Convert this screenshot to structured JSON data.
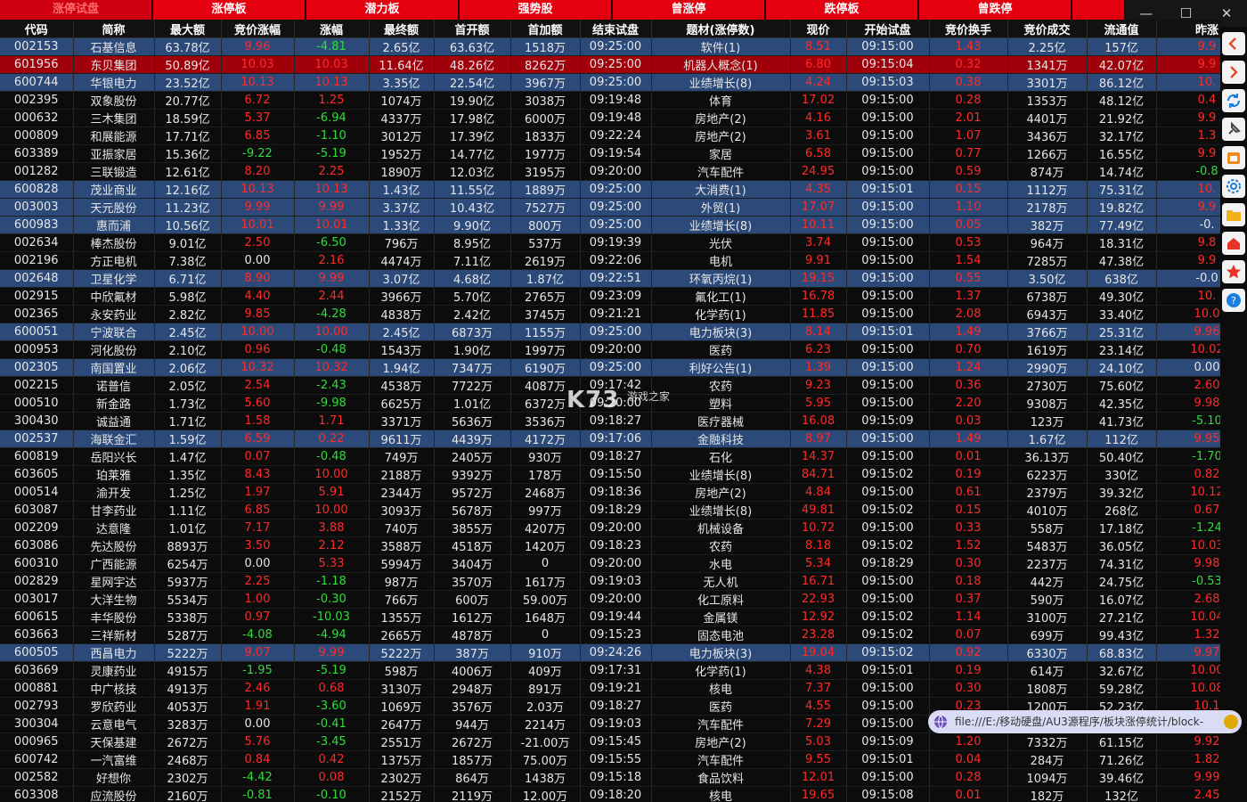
{
  "tabs": [
    "涨停试盘",
    "涨停板",
    "潜力板",
    "强势股",
    "曾涨停",
    "跌停板",
    "曾跌停",
    ""
  ],
  "window_controls": {
    "minimize": "—",
    "maximize": "☐",
    "close": "✕"
  },
  "columns": [
    "代码",
    "简称",
    "最大额",
    "竞价涨幅",
    "涨幅",
    "最终额",
    "首开额",
    "首加额",
    "结束试盘",
    "题材(涨停数)",
    "现价",
    "开始试盘",
    "竞价换手",
    "竞价成交",
    "流通值",
    "昨涨"
  ],
  "rows": [
    {
      "hl": "blue",
      "c": [
        "002153",
        "石基信息",
        "63.78亿",
        "9.96",
        "-4.81",
        "2.65亿",
        "63.63亿",
        "1518万",
        "09:25:00",
        "软件(1)",
        "8.51",
        "09:15:00",
        "1.43",
        "2.25亿",
        "157亿",
        "9.9"
      ]
    },
    {
      "hl": "red",
      "c": [
        "601956",
        "东贝集团",
        "50.89亿",
        "10.03",
        "10.03",
        "11.64亿",
        "48.26亿",
        "8262万",
        "09:25:00",
        "机器人概念(1)",
        "6.80",
        "09:15:04",
        "0.32",
        "1341万",
        "42.07亿",
        "9.9"
      ]
    },
    {
      "hl": "blue",
      "c": [
        "600744",
        "华银电力",
        "23.52亿",
        "10.13",
        "10.13",
        "3.35亿",
        "22.54亿",
        "3967万",
        "09:25:00",
        "业绩增长(8)",
        "4.24",
        "09:15:03",
        "0.38",
        "3301万",
        "86.12亿",
        "10."
      ]
    },
    {
      "hl": "",
      "c": [
        "002395",
        "双象股份",
        "20.77亿",
        "6.72",
        "1.25",
        "1074万",
        "19.90亿",
        "3038万",
        "09:19:48",
        "体育",
        "17.02",
        "09:15:00",
        "0.28",
        "1353万",
        "48.12亿",
        "0.4"
      ]
    },
    {
      "hl": "",
      "c": [
        "000632",
        "三木集团",
        "18.59亿",
        "5.37",
        "-6.94",
        "4337万",
        "17.98亿",
        "6000万",
        "09:19:48",
        "房地产(2)",
        "4.16",
        "09:15:00",
        "2.01",
        "4401万",
        "21.92亿",
        "9.9"
      ]
    },
    {
      "hl": "",
      "c": [
        "000809",
        "和展能源",
        "17.71亿",
        "6.85",
        "-1.10",
        "3012万",
        "17.39亿",
        "1833万",
        "09:22:24",
        "房地产(2)",
        "3.61",
        "09:15:00",
        "1.07",
        "3436万",
        "32.17亿",
        "1.3"
      ]
    },
    {
      "hl": "",
      "c": [
        "603389",
        "亚振家居",
        "15.36亿",
        "-9.22",
        "-5.19",
        "1952万",
        "14.77亿",
        "1977万",
        "09:19:54",
        "家居",
        "6.58",
        "09:15:00",
        "0.77",
        "1266万",
        "16.55亿",
        "9.9"
      ]
    },
    {
      "hl": "",
      "c": [
        "001282",
        "三联锻造",
        "12.61亿",
        "8.20",
        "2.25",
        "1890万",
        "12.03亿",
        "3195万",
        "09:20:00",
        "汽车配件",
        "24.95",
        "09:15:00",
        "0.59",
        "874万",
        "14.74亿",
        "-0.8"
      ]
    },
    {
      "hl": "blue",
      "c": [
        "600828",
        "茂业商业",
        "12.16亿",
        "10.13",
        "10.13",
        "1.43亿",
        "11.55亿",
        "1889万",
        "09:25:00",
        "大消费(1)",
        "4.35",
        "09:15:01",
        "0.15",
        "1112万",
        "75.31亿",
        "10."
      ]
    },
    {
      "hl": "blue",
      "c": [
        "003003",
        "天元股份",
        "11.23亿",
        "9.99",
        "9.99",
        "3.37亿",
        "10.43亿",
        "7527万",
        "09:25:00",
        "外贸(1)",
        "17.07",
        "09:15:00",
        "1.10",
        "2178万",
        "19.82亿",
        "9.9"
      ]
    },
    {
      "hl": "blue",
      "c": [
        "600983",
        "惠而浦",
        "10.56亿",
        "10.01",
        "10.01",
        "1.33亿",
        "9.90亿",
        "800万",
        "09:25:00",
        "业绩增长(8)",
        "10.11",
        "09:15:00",
        "0.05",
        "382万",
        "77.49亿",
        "-0."
      ]
    },
    {
      "hl": "",
      "c": [
        "002634",
        "棒杰股份",
        "9.01亿",
        "2.50",
        "-6.50",
        "796万",
        "8.95亿",
        "537万",
        "09:19:39",
        "光伏",
        "3.74",
        "09:15:00",
        "0.53",
        "964万",
        "18.31亿",
        "9.8"
      ]
    },
    {
      "hl": "",
      "c": [
        "002196",
        "方正电机",
        "7.38亿",
        "0.00",
        "2.16",
        "4474万",
        "7.11亿",
        "2619万",
        "09:22:06",
        "电机",
        "9.91",
        "09:15:00",
        "1.54",
        "7285万",
        "47.38亿",
        "9.9"
      ]
    },
    {
      "hl": "blue",
      "c": [
        "002648",
        "卫星化学",
        "6.71亿",
        "8.90",
        "9.99",
        "3.07亿",
        "4.68亿",
        "1.87亿",
        "09:22:51",
        "环氧丙烷(1)",
        "19.15",
        "09:15:00",
        "0.55",
        "3.50亿",
        "638亿",
        "-0.0"
      ]
    },
    {
      "hl": "",
      "c": [
        "002915",
        "中欣氟材",
        "5.98亿",
        "4.40",
        "2.44",
        "3966万",
        "5.70亿",
        "2765万",
        "09:23:09",
        "氟化工(1)",
        "16.78",
        "09:15:00",
        "1.37",
        "6738万",
        "49.30亿",
        "10."
      ]
    },
    {
      "hl": "",
      "c": [
        "002365",
        "永安药业",
        "2.82亿",
        "9.85",
        "-4.28",
        "4838万",
        "2.42亿",
        "3745万",
        "09:21:21",
        "化学药(1)",
        "11.85",
        "09:15:00",
        "2.08",
        "6943万",
        "33.40亿",
        "10.0"
      ]
    },
    {
      "hl": "blue",
      "c": [
        "600051",
        "宁波联合",
        "2.45亿",
        "10.00",
        "10.00",
        "2.45亿",
        "6873万",
        "1155万",
        "09:25:00",
        "电力板块(3)",
        "8.14",
        "09:15:01",
        "1.49",
        "3766万",
        "25.31亿",
        "9.96"
      ]
    },
    {
      "hl": "",
      "c": [
        "000953",
        "河化股份",
        "2.10亿",
        "0.96",
        "-0.48",
        "1543万",
        "1.90亿",
        "1997万",
        "09:20:00",
        "医药",
        "6.23",
        "09:15:00",
        "0.70",
        "1619万",
        "23.14亿",
        "10.02"
      ]
    },
    {
      "hl": "blue",
      "c": [
        "002305",
        "南国置业",
        "2.06亿",
        "10.32",
        "10.32",
        "1.94亿",
        "7347万",
        "6190万",
        "09:25:00",
        "利好公告(1)",
        "1.39",
        "09:15:00",
        "1.24",
        "2990万",
        "24.10亿",
        "0.00"
      ]
    },
    {
      "hl": "",
      "c": [
        "002215",
        "诺普信",
        "2.05亿",
        "2.54",
        "-2.43",
        "4538万",
        "7722万",
        "4087万",
        "09:17:42",
        "农药",
        "9.23",
        "09:15:00",
        "0.36",
        "2730万",
        "75.60亿",
        "2.60"
      ]
    },
    {
      "hl": "",
      "c": [
        "000510",
        "新金路",
        "1.73亿",
        "5.60",
        "-9.98",
        "6625万",
        "1.01亿",
        "6372万",
        "09:20:00",
        "塑料",
        "5.95",
        "09:15:00",
        "2.20",
        "9308万",
        "42.35亿",
        "9.98"
      ]
    },
    {
      "hl": "",
      "c": [
        "300430",
        "诚益通",
        "1.71亿",
        "1.58",
        "1.71",
        "3371万",
        "5636万",
        "3536万",
        "09:18:27",
        "医疗器械",
        "16.08",
        "09:15:09",
        "0.03",
        "123万",
        "41.73亿",
        "-5.10"
      ]
    },
    {
      "hl": "blue",
      "c": [
        "002537",
        "海联金汇",
        "1.59亿",
        "6.59",
        "0.22",
        "9611万",
        "4439万",
        "4172万",
        "09:17:06",
        "金融科技",
        "8.97",
        "09:15:00",
        "1.49",
        "1.67亿",
        "112亿",
        "9.95"
      ]
    },
    {
      "hl": "",
      "c": [
        "600819",
        "岳阳兴长",
        "1.47亿",
        "0.07",
        "-0.48",
        "749万",
        "2405万",
        "930万",
        "09:18:27",
        "石化",
        "14.37",
        "09:15:00",
        "0.01",
        "36.13万",
        "50.40亿",
        "-1.70"
      ]
    },
    {
      "hl": "",
      "c": [
        "603605",
        "珀莱雅",
        "1.35亿",
        "8.43",
        "10.00",
        "2188万",
        "9392万",
        "178万",
        "09:15:50",
        "业绩增长(8)",
        "84.71",
        "09:15:02",
        "0.19",
        "6223万",
        "330亿",
        "0.82"
      ]
    },
    {
      "hl": "",
      "c": [
        "000514",
        "渝开发",
        "1.25亿",
        "1.97",
        "5.91",
        "2344万",
        "9572万",
        "2468万",
        "09:18:36",
        "房地产(2)",
        "4.84",
        "09:15:00",
        "0.61",
        "2379万",
        "39.32亿",
        "10.12"
      ]
    },
    {
      "hl": "",
      "c": [
        "603087",
        "甘李药业",
        "1.11亿",
        "6.85",
        "10.00",
        "3093万",
        "5678万",
        "997万",
        "09:18:29",
        "业绩增长(8)",
        "49.81",
        "09:15:02",
        "0.15",
        "4010万",
        "268亿",
        "0.67"
      ]
    },
    {
      "hl": "",
      "c": [
        "002209",
        "达意隆",
        "1.01亿",
        "7.17",
        "3.88",
        "740万",
        "3855万",
        "4207万",
        "09:20:00",
        "机械设备",
        "10.72",
        "09:15:00",
        "0.33",
        "558万",
        "17.18亿",
        "-1.24"
      ]
    },
    {
      "hl": "",
      "c": [
        "603086",
        "先达股份",
        "8893万",
        "3.50",
        "2.12",
        "3588万",
        "4518万",
        "1420万",
        "09:18:23",
        "农药",
        "8.18",
        "09:15:02",
        "1.52",
        "5483万",
        "36.05亿",
        "10.03"
      ]
    },
    {
      "hl": "",
      "c": [
        "600310",
        "广西能源",
        "6254万",
        "0.00",
        "5.33",
        "5994万",
        "3404万",
        "0",
        "09:20:00",
        "水电",
        "5.34",
        "09:18:29",
        "0.30",
        "2237万",
        "74.31亿",
        "9.98"
      ]
    },
    {
      "hl": "",
      "c": [
        "002829",
        "星网宇达",
        "5937万",
        "2.25",
        "-1.18",
        "987万",
        "3570万",
        "1617万",
        "09:19:03",
        "无人机",
        "16.71",
        "09:15:00",
        "0.18",
        "442万",
        "24.75亿",
        "-0.53"
      ]
    },
    {
      "hl": "",
      "c": [
        "003017",
        "大洋生物",
        "5534万",
        "1.00",
        "-0.30",
        "766万",
        "600万",
        "59.00万",
        "09:20:00",
        "化工原料",
        "22.93",
        "09:15:00",
        "0.37",
        "590万",
        "16.07亿",
        "2.68"
      ]
    },
    {
      "hl": "",
      "c": [
        "600615",
        "丰华股份",
        "5338万",
        "0.97",
        "-10.03",
        "1355万",
        "1612万",
        "1648万",
        "09:19:44",
        "金属镁",
        "12.92",
        "09:15:02",
        "1.14",
        "3100万",
        "27.21亿",
        "10.04"
      ]
    },
    {
      "hl": "",
      "c": [
        "603663",
        "三祥新材",
        "5287万",
        "-4.08",
        "-4.94",
        "2665万",
        "4878万",
        "0",
        "09:15:23",
        "固态电池",
        "23.28",
        "09:15:02",
        "0.07",
        "699万",
        "99.43亿",
        "1.32"
      ]
    },
    {
      "hl": "blue",
      "c": [
        "600505",
        "西昌电力",
        "5222万",
        "9.07",
        "9.99",
        "5222万",
        "387万",
        "910万",
        "09:24:26",
        "电力板块(3)",
        "19.04",
        "09:15:02",
        "0.92",
        "6330万",
        "68.83亿",
        "9.97"
      ]
    },
    {
      "hl": "",
      "c": [
        "603669",
        "灵康药业",
        "4915万",
        "-1.95",
        "-5.19",
        "598万",
        "4006万",
        "409万",
        "09:17:31",
        "化学药(1)",
        "4.38",
        "09:15:01",
        "0.19",
        "614万",
        "32.67亿",
        "10.00"
      ]
    },
    {
      "hl": "",
      "c": [
        "000881",
        "中广核技",
        "4913万",
        "2.46",
        "0.68",
        "3130万",
        "2948万",
        "891万",
        "09:19:21",
        "核电",
        "7.37",
        "09:15:00",
        "0.30",
        "1808万",
        "59.28亿",
        "10.08"
      ]
    },
    {
      "hl": "",
      "c": [
        "002793",
        "罗欣药业",
        "4053万",
        "1.91",
        "-3.60",
        "1069万",
        "3576万",
        "2.03万",
        "09:18:27",
        "医药",
        "4.55",
        "09:15:00",
        "0.23",
        "1200万",
        "52.23亿",
        "10.1"
      ]
    },
    {
      "hl": "",
      "c": [
        "300304",
        "云意电气",
        "3283万",
        "0.00",
        "-0.41",
        "2647万",
        "944万",
        "2214万",
        "09:19:03",
        "汽车配件",
        "7.29",
        "09:15:00",
        "0.61",
        "1917万",
        "42.03亿",
        "0.3"
      ]
    },
    {
      "hl": "",
      "c": [
        "000965",
        "天保基建",
        "2672万",
        "5.76",
        "-3.45",
        "2551万",
        "2672万",
        "-21.00万",
        "09:15:45",
        "房地产(2)",
        "5.03",
        "09:15:09",
        "1.20",
        "7332万",
        "61.15亿",
        "9.92"
      ]
    },
    {
      "hl": "",
      "c": [
        "600742",
        "一汽富维",
        "2468万",
        "0.84",
        "0.42",
        "1375万",
        "1857万",
        "75.00万",
        "09:15:55",
        "汽车配件",
        "9.55",
        "09:15:01",
        "0.04",
        "284万",
        "71.26亿",
        "1.82"
      ]
    },
    {
      "hl": "",
      "c": [
        "002582",
        "好想你",
        "2302万",
        "-4.42",
        "0.08",
        "2302万",
        "864万",
        "1438万",
        "09:15:18",
        "食品饮料",
        "12.01",
        "09:15:00",
        "0.28",
        "1094万",
        "39.46亿",
        "9.99"
      ]
    },
    {
      "hl": "",
      "c": [
        "603308",
        "应流股份",
        "2160万",
        "-0.81",
        "-0.10",
        "2152万",
        "2119万",
        "12.00万",
        "09:18:20",
        "核电",
        "19.65",
        "09:15:08",
        "0.01",
        "182万",
        "132亿",
        "2.45"
      ]
    }
  ],
  "side_tools": [
    "arrow-left-icon",
    "arrow-right-icon",
    "refresh-icon",
    "pin-icon",
    "calendar-icon",
    "gear-icon",
    "folder-icon",
    "home-icon",
    "star-icon",
    "help-icon"
  ],
  "url_tip": "file:///E:/移动硬盘/AU3源程序/板块涨停统计/block-",
  "watermark": {
    "brand": "K73",
    "sub": "游戏之家"
  },
  "colors": {
    "tab_bg": "#e4000e",
    "row_blue": "#2b4a7a",
    "row_red": "#a0000a",
    "up": "#ff2a2a",
    "down": "#2fdc3c"
  }
}
